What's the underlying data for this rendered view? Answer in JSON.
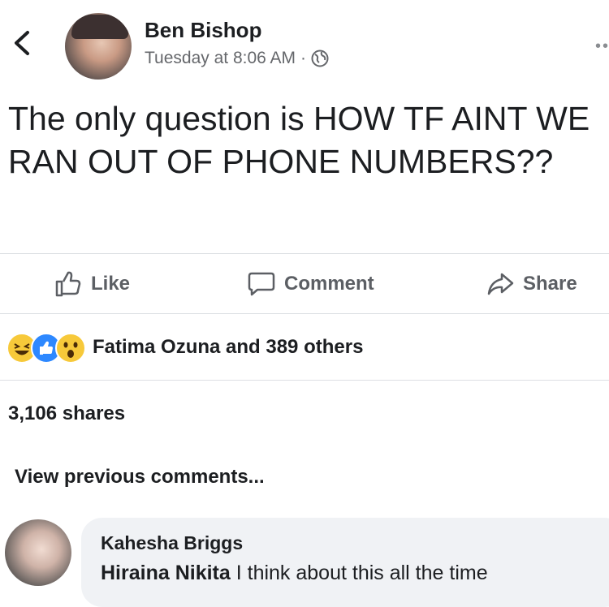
{
  "post": {
    "author": "Ben Bishop",
    "timestamp": "Tuesday at 8:06 AM",
    "separator": "·",
    "privacy_icon": "globe-icon",
    "text": "The only question is HOW TF AINT WE RAN OUT OF PHONE NUMBERS??"
  },
  "actions": {
    "like": "Like",
    "comment": "Comment",
    "share": "Share"
  },
  "reactions": {
    "icons": [
      "haha-reaction-icon",
      "like-reaction-icon",
      "wow-reaction-icon"
    ],
    "summary": "Fatima Ozuna and 389 others"
  },
  "shares": "3,106 shares",
  "view_previous": "View previous comments...",
  "comment": {
    "author": "Kahesha Briggs",
    "mention": "Hiraina Nikita",
    "text": " I think about this all the time"
  },
  "colors": {
    "like_blue": "#2d88ff",
    "reaction_yellow": "#f7c93a",
    "meta_gray": "#65676b",
    "bubble_bg": "#f0f2f5"
  }
}
